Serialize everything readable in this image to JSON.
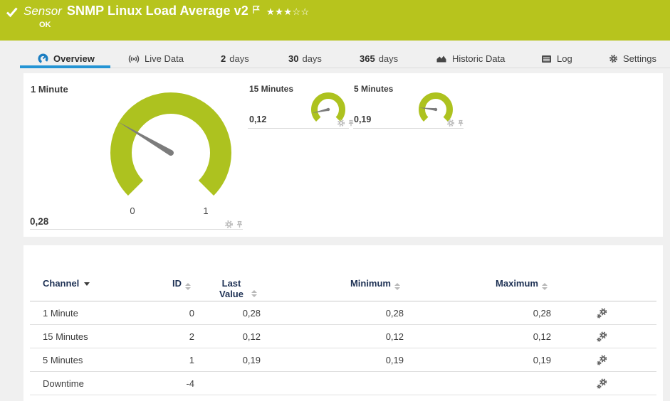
{
  "header": {
    "kind_label": "Sensor",
    "title": "SNMP Linux Load Average v2",
    "status": "OK",
    "rating_display": "★★★☆☆",
    "rating_filled": 3,
    "rating_total": 5,
    "status_color": "#b7c41d"
  },
  "tabs": {
    "overview": {
      "label": "Overview",
      "active": true
    },
    "live_data": {
      "label": "Live Data"
    },
    "days2": {
      "num": "2",
      "unit": "days"
    },
    "days30": {
      "num": "30",
      "unit": "days"
    },
    "days365": {
      "num": "365",
      "unit": "days"
    },
    "historic": {
      "label": "Historic Data"
    },
    "log": {
      "label": "Log"
    },
    "settings": {
      "label": "Settings"
    }
  },
  "gauges": {
    "one_minute": {
      "name": "1 Minute",
      "value": "0,28",
      "value_num": 0.28,
      "scale_min": "0",
      "scale_max": "1"
    },
    "fifteen_minutes": {
      "name": "15 Minutes",
      "value": "0,12",
      "value_num": 0.12
    },
    "five_minutes": {
      "name": "5 Minutes",
      "value": "0,19",
      "value_num": 0.19
    }
  },
  "table": {
    "headers": {
      "channel": "Channel",
      "id": "ID",
      "last_value": "Last Value",
      "minimum": "Minimum",
      "maximum": "Maximum"
    },
    "rows": [
      {
        "channel": "1 Minute",
        "id": "0",
        "last_value": "0,28",
        "minimum": "0,28",
        "maximum": "0,28"
      },
      {
        "channel": "15 Minutes",
        "id": "2",
        "last_value": "0,12",
        "minimum": "0,12",
        "maximum": "0,12"
      },
      {
        "channel": "5 Minutes",
        "id": "1",
        "last_value": "0,19",
        "minimum": "0,19",
        "maximum": "0,19"
      },
      {
        "channel": "Downtime",
        "id": "-4",
        "last_value": "",
        "minimum": "",
        "maximum": ""
      }
    ]
  },
  "chart_data": [
    {
      "type": "gauge",
      "title": "1 Minute",
      "value": 0.28,
      "min": 0,
      "max": 1
    },
    {
      "type": "gauge",
      "title": "15 Minutes",
      "value": 0.12,
      "min": 0,
      "max": 1
    },
    {
      "type": "gauge",
      "title": "5 Minutes",
      "value": 0.19,
      "min": 0,
      "max": 1
    }
  ],
  "colors": {
    "gauge_green": "#adc21f",
    "needle_gray": "#7c7c7c",
    "active_tab_blue": "#2494d4"
  }
}
